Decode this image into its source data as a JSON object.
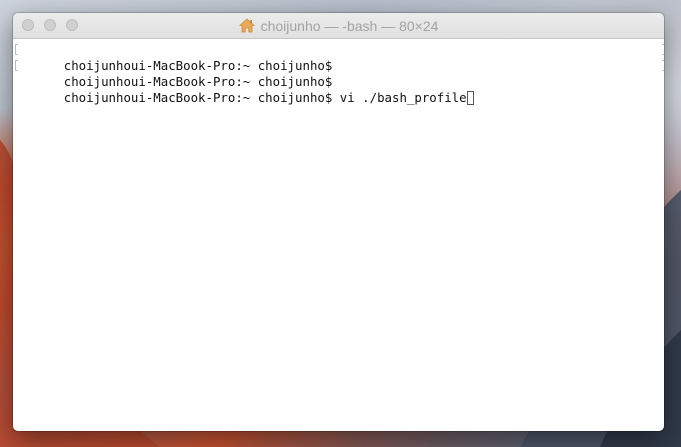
{
  "window": {
    "title": "choijunho — -bash — 80×24"
  },
  "terminal": {
    "lines": [
      {
        "prompt": "choijunhoui-MacBook-Pro:~ choijunho$",
        "command": ""
      },
      {
        "prompt": "choijunhoui-MacBook-Pro:~ choijunho$",
        "command": ""
      },
      {
        "prompt": "choijunhoui-MacBook-Pro:~ choijunho$",
        "command": " vi ./bash_profile"
      }
    ]
  },
  "icons": {
    "window_icon": "home-icon",
    "cursor": "text-cursor"
  }
}
